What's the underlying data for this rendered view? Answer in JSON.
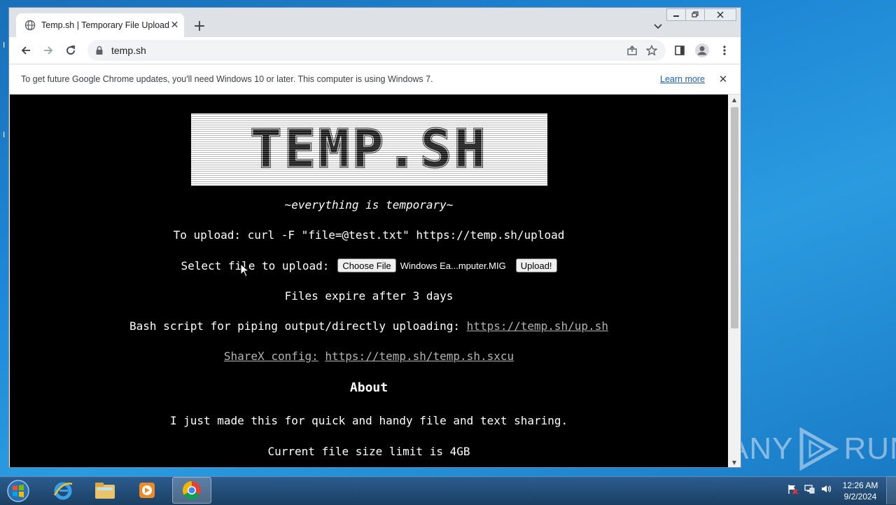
{
  "browser": {
    "tab_title": "Temp.sh | Temporary File Upload",
    "url": "temp.sh",
    "infobar_text": "To get future Google Chrome updates, you'll need Windows 10 or later. This computer is using Windows 7.",
    "infobar_link": "Learn more"
  },
  "page": {
    "logo_text": "TEMP.SH",
    "tagline": "~everything is temporary~",
    "upload_command": "To upload: curl -F \"file=@test.txt\" https://temp.sh/upload",
    "select_label": "Select file to upload:",
    "choose_file_label": "Choose File",
    "chosen_file_name": "Windows Ea...mputer.MIG",
    "upload_button_label": "Upload!",
    "expire_text": "Files expire after 3 days",
    "bash_label": "Bash script for piping output/directly uploading:",
    "bash_link": "https://temp.sh/up.sh",
    "sharex_label": "ShareX config:",
    "sharex_link": "https://temp.sh/temp.sh.sxcu",
    "about_heading": "About",
    "about_text": "I just made this for quick and handy file and text sharing.",
    "size_limit_text": "Current file size limit is 4GB"
  },
  "taskbar": {
    "apps": [
      "start-orb",
      "internet-explorer-icon",
      "file-explorer-icon",
      "media-player-icon",
      "chrome-icon"
    ],
    "clock_time": "12:26 AM",
    "clock_date": "9/2/2024"
  },
  "watermark": {
    "left": "ANY",
    "right": "RUN"
  },
  "colors": {
    "page_bg": "#000000",
    "link": "#b4b4b4",
    "desktop": "#1e88d6"
  }
}
